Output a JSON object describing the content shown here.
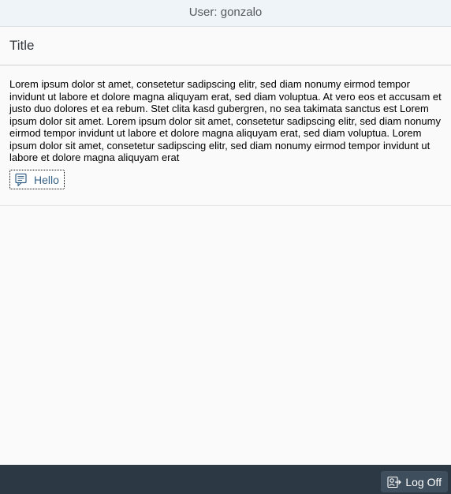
{
  "header": {
    "user_label": "User: gonzalo"
  },
  "page": {
    "title": "Title"
  },
  "content": {
    "text": "Lorem ipsum dolor st amet, consetetur sadipscing elitr, sed diam nonumy eirmod tempor invidunt ut labore et dolore magna aliquyam erat, sed diam voluptua. At vero eos et accusam et justo duo dolores et ea rebum. Stet clita kasd gubergren, no sea takimata sanctus est Lorem ipsum dolor sit amet. Lorem ipsum dolor sit amet, consetetur sadipscing elitr, sed diam nonumy eirmod tempor invidunt ut labore et dolore magna aliquyam erat, sed diam voluptua. Lorem ipsum dolor sit amet, consetetur sadipscing elitr, sed diam nonumy eirmod tempor invidunt ut labore et dolore magna aliquyam erat",
    "hello_button": {
      "label": "Hello",
      "icon": "message-popup-icon"
    }
  },
  "footer": {
    "logoff_button": {
      "label": "Log Off",
      "icon": "log-off-icon"
    }
  },
  "colors": {
    "header_bg": "#eff4f9",
    "page_bg": "#fafafa",
    "footer_bg": "#2c3843",
    "link_text": "#346187"
  }
}
